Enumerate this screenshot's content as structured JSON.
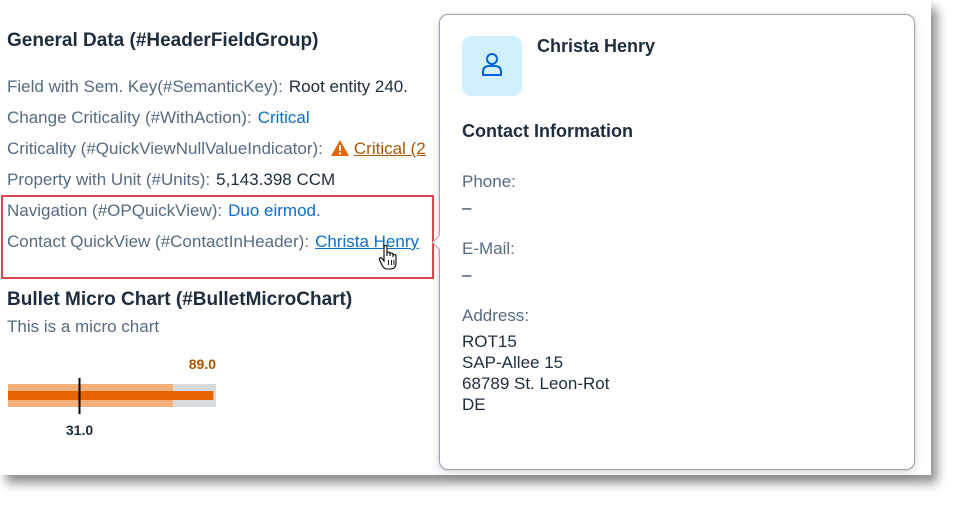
{
  "header_group": {
    "title": "General Data (#HeaderFieldGroup)",
    "fields": [
      {
        "label": "Field with Sem. Key(#SemanticKey):",
        "value": "Root entity 240."
      },
      {
        "label": "Change Criticality (#WithAction):",
        "value": "Critical"
      },
      {
        "label": "Criticality (#QuickViewNullValueIndicator):",
        "value": "Critical (2"
      },
      {
        "label": "Property with Unit (#Units):",
        "value": "5,143.398 CCM"
      },
      {
        "label": "Navigation (#OPQuickView):",
        "value": "Duo eirmod."
      },
      {
        "label": "Contact QuickView (#ContactInHeader):",
        "value": "Christa Henry"
      }
    ]
  },
  "micro_chart": {
    "title": "Bullet Micro Chart (#BulletMicroChart)",
    "subtitle": "This is a micro chart"
  },
  "chart_data": {
    "type": "bar",
    "subtype": "bullet",
    "actual_value": 89.0,
    "actual_label": "89.0",
    "target_value": 31.0,
    "target_label": "31.0",
    "colors": {
      "actual": "#e76500",
      "range": "#f5b07a",
      "background": "#d5dadd",
      "label": "#aa5500"
    }
  },
  "popover": {
    "name": "Christa Henry",
    "heading": "Contact Information",
    "phone_label": "Phone:",
    "phone_value": "–",
    "email_label": "E-Mail:",
    "email_value": "–",
    "address_label": "Address:",
    "address_lines": [
      "ROT15",
      "SAP-Allee 15",
      "68789 St. Leon-Rot",
      "DE"
    ]
  },
  "colors": {
    "link": "#0a6ed1",
    "critical": "#aa5500",
    "warning_icon": "#e76500",
    "highlight": "#e0454c",
    "avatar_bg": "#d1efff"
  },
  "icons": [
    "warning-icon",
    "person-icon",
    "hand-cursor-icon"
  ]
}
